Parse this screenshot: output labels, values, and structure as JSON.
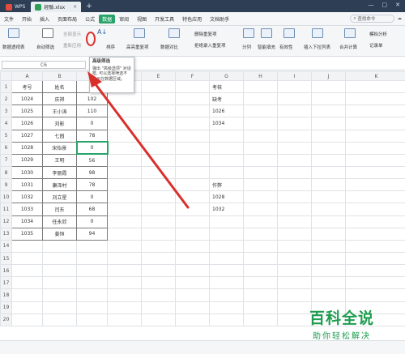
{
  "tabs": [
    {
      "label": "WPS"
    },
    {
      "label": "經驗.xlsx"
    }
  ],
  "new_tab": "+",
  "menu": [
    "文件",
    "开始",
    "插入",
    "页面布局",
    "公式",
    "数据",
    "审阅",
    "视图",
    "开发工具",
    "特色应用",
    "文档助手"
  ],
  "active_menu": "数据",
  "search_label": "查找命令",
  "ribbon": {
    "pivot": "数据透视表",
    "autofilter": "自动筛选",
    "all_show": "全部显示",
    "reapply": "重新应用",
    "sort": "排序",
    "highlight_dup": "高亮重复项",
    "dedup": "删除重复项",
    "reject_dup": "拒绝录入重复项",
    "data_compare": "数据对比",
    "split": "分列",
    "smart_fill": "智能填充",
    "validity": "有效性",
    "insert_dropdown": "插入下拉列表",
    "merge_calc": "合并计算",
    "simulate": "模拟分析",
    "record": "记录单"
  },
  "namebox": "C6",
  "tooltip": {
    "title": "高级筛选",
    "body": "弹出 \"高级选项\" 对话框, 可以选择筛选不显示在数据区域。"
  },
  "columns": [
    "A",
    "B",
    "C",
    "D",
    "E",
    "F",
    "G",
    "H",
    "I",
    "J",
    "K"
  ],
  "rows": [
    {
      "num": "1",
      "a": "考号",
      "b": "姓名",
      "c": "大",
      "g": "考核"
    },
    {
      "num": "2",
      "a": "1024",
      "b": "庆祺",
      "c": "102",
      "g": "缺考"
    },
    {
      "num": "3",
      "a": "1025",
      "b": "王小涛",
      "c": "110",
      "g": "1026"
    },
    {
      "num": "4",
      "a": "1026",
      "b": "刘影",
      "c": "0",
      "g": "1034"
    },
    {
      "num": "5",
      "a": "1027",
      "b": "七园",
      "c": "78",
      "g": ""
    },
    {
      "num": "6",
      "a": "1028",
      "b": "宋怡景",
      "c": "0",
      "g": ""
    },
    {
      "num": "7",
      "a": "1029",
      "b": "王明",
      "c": "56",
      "g": ""
    },
    {
      "num": "8",
      "a": "1030",
      "b": "李丽霞",
      "c": "98",
      "g": ""
    },
    {
      "num": "9",
      "a": "1031",
      "b": "康泽村",
      "c": "78",
      "g": "作弊"
    },
    {
      "num": "10",
      "a": "1032",
      "b": "刘立星",
      "c": "0",
      "g": "1028"
    },
    {
      "num": "11",
      "a": "1033",
      "b": "闫东",
      "c": "68",
      "g": "1032"
    },
    {
      "num": "12",
      "a": "1034",
      "b": "任永欣",
      "c": "0",
      "g": ""
    },
    {
      "num": "13",
      "a": "1035",
      "b": "姜恒",
      "c": "94",
      "g": ""
    },
    {
      "num": "14",
      "a": "",
      "b": "",
      "c": "",
      "g": ""
    },
    {
      "num": "15",
      "a": "",
      "b": "",
      "c": "",
      "g": ""
    },
    {
      "num": "16",
      "a": "",
      "b": "",
      "c": "",
      "g": ""
    },
    {
      "num": "17",
      "a": "",
      "b": "",
      "c": "",
      "g": ""
    },
    {
      "num": "18",
      "a": "",
      "b": "",
      "c": "",
      "g": ""
    },
    {
      "num": "19",
      "a": "",
      "b": "",
      "c": "",
      "g": ""
    },
    {
      "num": "20",
      "a": "",
      "b": "",
      "c": "",
      "g": ""
    }
  ],
  "watermark": {
    "big": "百科全说",
    "small": "助你轻松解决"
  },
  "colors": {
    "accent": "#29a36a",
    "arrow": "#d9302c",
    "titlebar": "#2d3e55",
    "watermark": "#1e9d4f"
  }
}
